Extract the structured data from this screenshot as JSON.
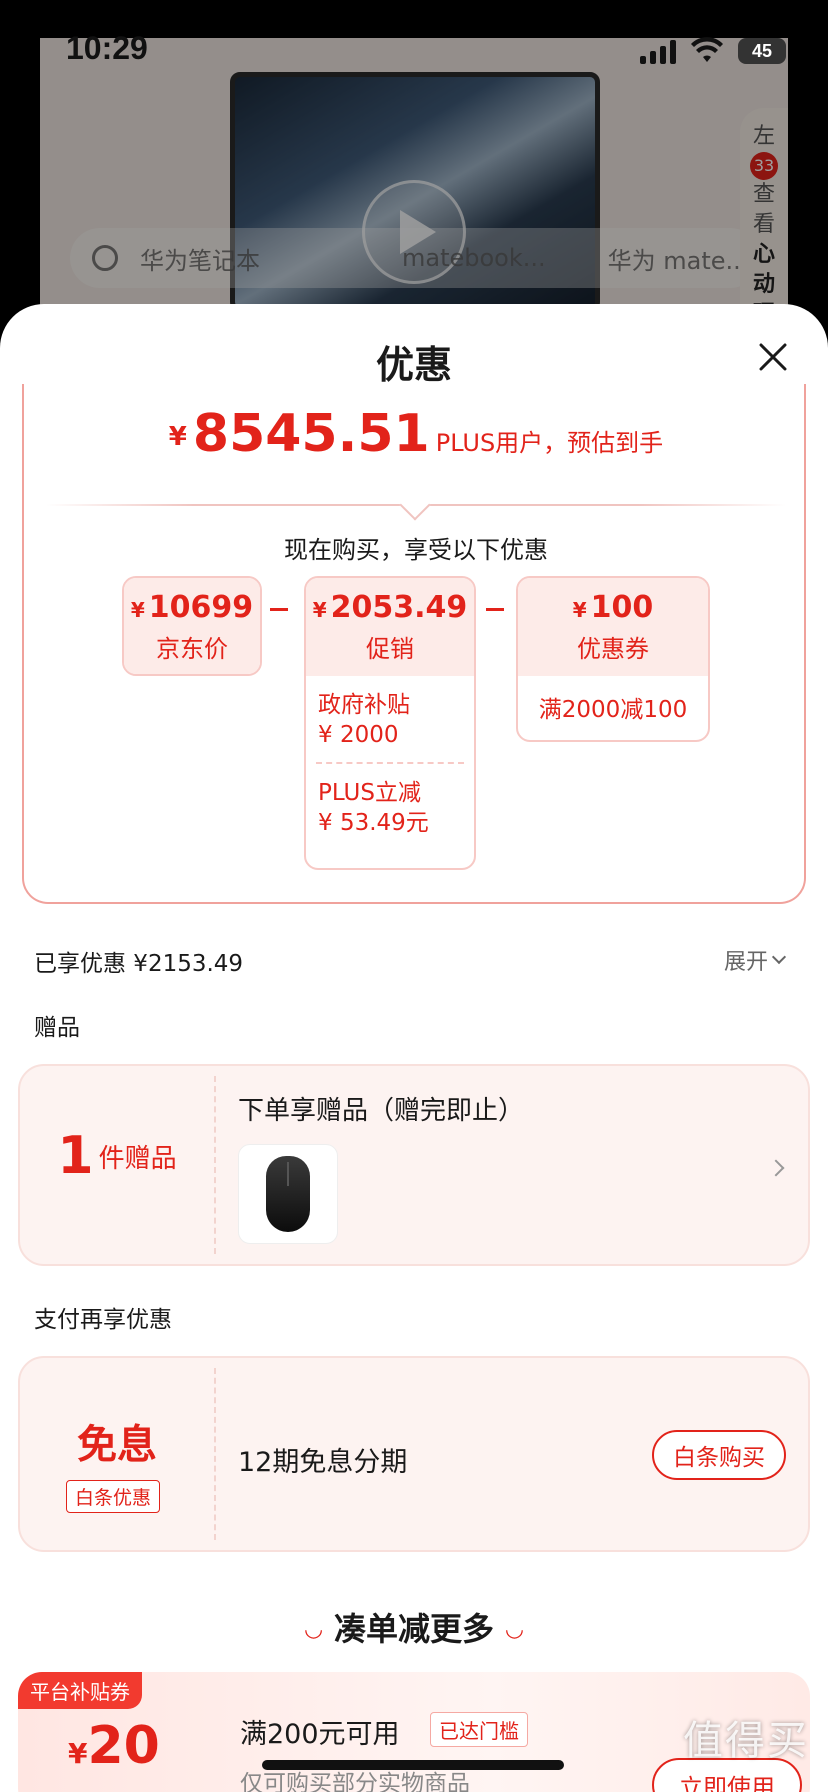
{
  "status_bar": {
    "time": "10:29",
    "battery": "45"
  },
  "background": {
    "search_placeholder": "华为笔记本",
    "search_chips": [
      "matebook...",
      "华为 mate..."
    ],
    "side_panel": {
      "line1": "左",
      "badge": "33",
      "line2": "查",
      "line3": "看",
      "line4": "心",
      "line5": "动",
      "line6": "理"
    }
  },
  "sheet": {
    "title": "优惠"
  },
  "price_summary": {
    "currency": "¥",
    "final_price": "8545.51",
    "note": "PLUS用户，预估到手",
    "subheading": "现在购买，享受以下优惠"
  },
  "breakdown": {
    "jd_price": {
      "currency": "¥",
      "value": "10699",
      "label": "京东价"
    },
    "promotion": {
      "currency": "¥",
      "value": "2053.49",
      "label": "促销",
      "items": [
        {
          "name": "政府补贴",
          "amount": "¥ 2000"
        },
        {
          "name": "PLUS立减",
          "amount": "¥ 53.49元"
        }
      ]
    },
    "coupon": {
      "currency": "¥",
      "value": "100",
      "label": "优惠券",
      "detail": "满2000减100"
    }
  },
  "enjoyed": {
    "label": "已享优惠 ¥2153.49",
    "expand": "展开"
  },
  "gifts": {
    "section_title": "赠品",
    "count": "1",
    "count_unit": "件赠品",
    "title": "下单享赠品（赠完即止）"
  },
  "payment": {
    "section_title": "支付再享优惠",
    "headline": "免息",
    "badge": "白条优惠",
    "description": "12期免息分期",
    "button": "白条购买"
  },
  "more": {
    "title": "凑单减更多",
    "coupon": {
      "tag": "平台补贴券",
      "currency": "¥",
      "amount": "20",
      "condition": "满200元可用",
      "reached": "已达门槛",
      "scope": "仅可购买部分实物商品",
      "button": "立即使用"
    }
  },
  "watermark": "值得买",
  "colors": {
    "accent": "#e2231a",
    "card_bg": "#fdf3f1",
    "promo_head_bg": "#fdebe8"
  }
}
